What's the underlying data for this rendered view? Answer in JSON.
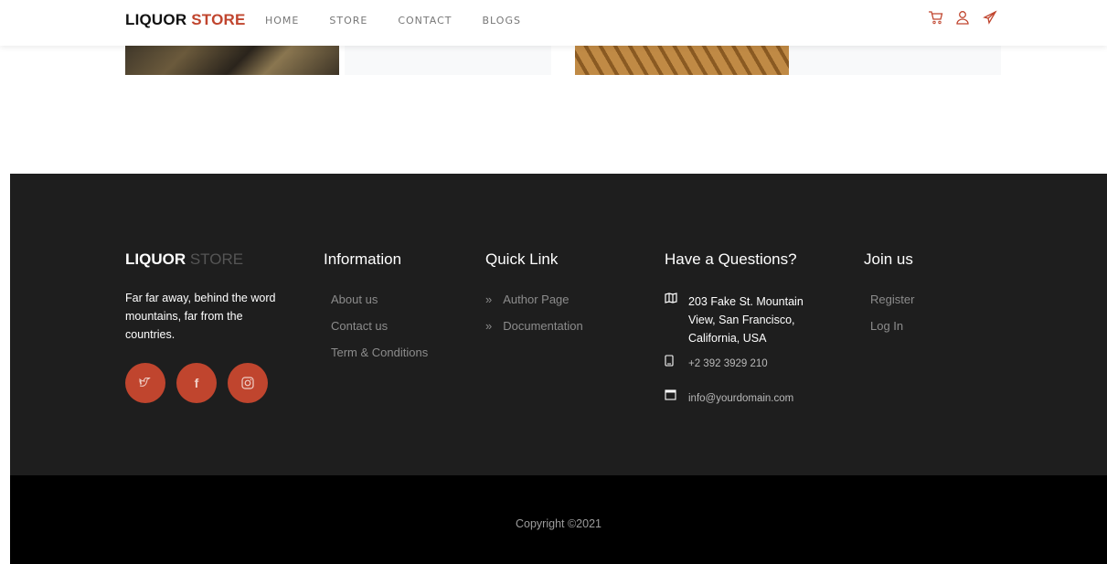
{
  "header": {
    "brand_part1": "LIQUOR",
    "brand_part2": "STORE",
    "nav": [
      "HOME",
      "STORE",
      "CONTACT",
      "BLOGS"
    ],
    "icons": [
      "cart-icon",
      "user-icon",
      "send-icon"
    ],
    "accent_color": "#c0452e"
  },
  "footer": {
    "brand_part1": "LIQUOR",
    "brand_part2": "STORE",
    "about_text": "Far far away, behind the word mountains, far from the countries.",
    "social": [
      {
        "icon": "twitter-icon",
        "glyph": "ᘊ"
      },
      {
        "icon": "facebook-icon",
        "glyph": "f"
      },
      {
        "icon": "instagram-icon",
        "glyph": "◎"
      }
    ],
    "information": {
      "title": "Information",
      "links": [
        "About us",
        "Contact us",
        "Term & Conditions"
      ]
    },
    "quick_link": {
      "title": "Quick Link",
      "links": [
        "Author Page",
        "Documentation"
      ]
    },
    "questions": {
      "title": "Have a Questions?",
      "address": "203 Fake St. Mountain View, San Francisco, California, USA",
      "phone": "+2 392 3929 210",
      "email": "info@yourdomain.com"
    },
    "join": {
      "title": "Join us",
      "links": [
        "Register",
        "Log In"
      ]
    },
    "copyright": "Copyright ©2021"
  }
}
